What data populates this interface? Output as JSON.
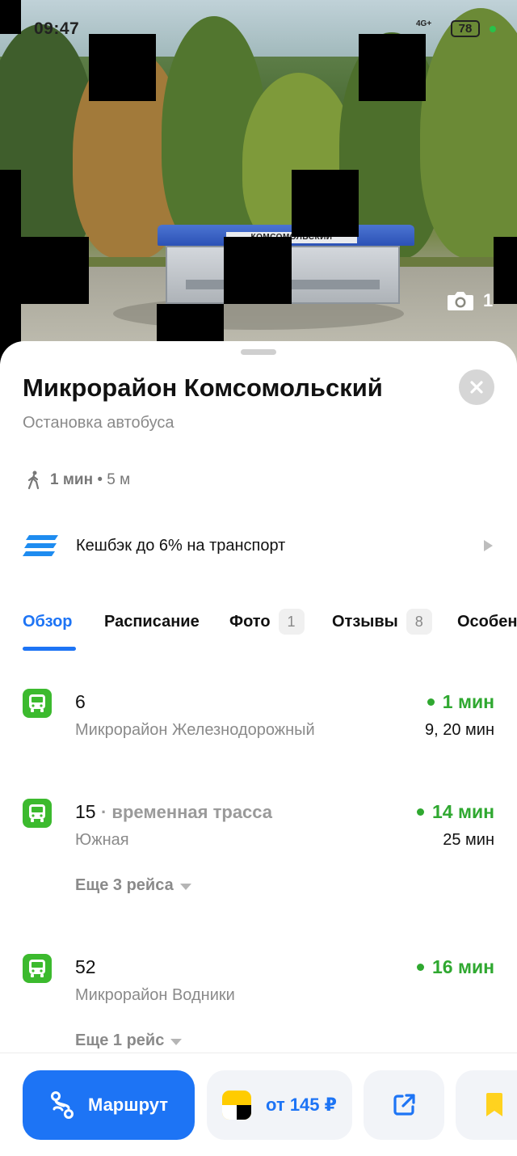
{
  "status_bar": {
    "time": "09:47",
    "network": "4G+",
    "battery": "78"
  },
  "photo": {
    "sign_text": "КОМСОМОЛЬСКИЙ",
    "count": "1"
  },
  "stop": {
    "title": "Микрорайон Комсомольский",
    "subtitle": "Остановка автобуса",
    "walk_time": "1 мин",
    "walk_separator": "•",
    "walk_distance": "5 м"
  },
  "cashback": {
    "text": "Кешбэк до 6% на транспорт"
  },
  "tabs": [
    {
      "label": "Обзор",
      "badge": ""
    },
    {
      "label": "Расписание",
      "badge": ""
    },
    {
      "label": "Фото",
      "badge": "1"
    },
    {
      "label": "Отзывы",
      "badge": "8"
    },
    {
      "label": "Особен",
      "badge": ""
    }
  ],
  "routes": [
    {
      "number": "6",
      "note": "",
      "destination": "Микрорайон Железнодорожный",
      "arrival": "1 мин",
      "next": "9, 20 мин",
      "more": ""
    },
    {
      "number": "15",
      "note": "· временная трасса",
      "destination": "Южная",
      "arrival": "14 мин",
      "next": "25 мин",
      "more": "Еще 3 рейса"
    },
    {
      "number": "52",
      "note": "",
      "destination": "Микрорайон Водники",
      "arrival": "16 мин",
      "next": "",
      "more": "Еще 1 рейс"
    }
  ],
  "bottom_bar": {
    "route_label": "Маршрут",
    "taxi_label": "от 145 ₽"
  },
  "colors": {
    "accent": "#1d74f5",
    "bus": "#3cba2e",
    "arrival": "#2fa830",
    "bookmark": "#ffd21f"
  }
}
